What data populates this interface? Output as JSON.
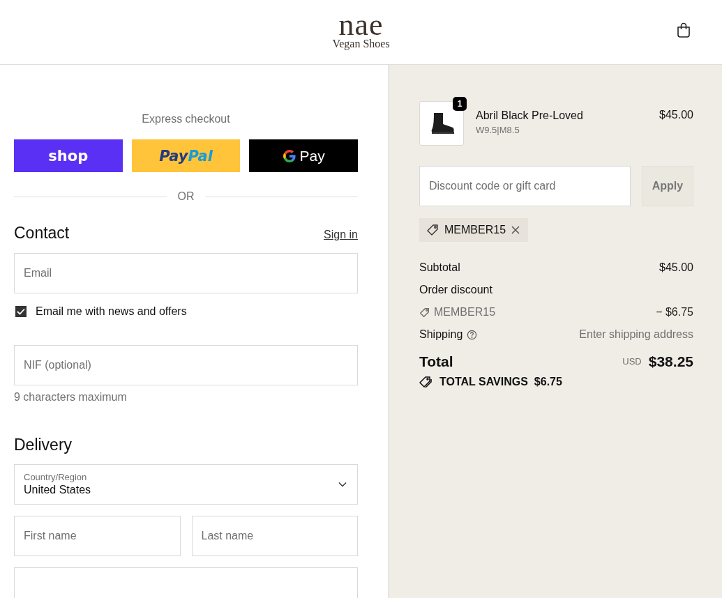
{
  "header": {
    "logo": "nae",
    "tagline": "Vegan Shoes"
  },
  "express_checkout": {
    "title": "Express checkout",
    "buttons": [
      {
        "kind": "shop",
        "label": "shop"
      },
      {
        "kind": "paypal",
        "label": "Pay",
        "label_2": "Pal"
      },
      {
        "kind": "gpay",
        "label": "Pay"
      }
    ],
    "divider": "OR"
  },
  "contact": {
    "heading": "Contact",
    "sign_in": "Sign in",
    "email": {
      "placeholder": "Email"
    },
    "newsletter": {
      "label": "Email me with news and offers",
      "checked": true
    },
    "nif": {
      "placeholder": "NIF (optional)",
      "hint": "9 characters maximum"
    }
  },
  "delivery": {
    "heading": "Delivery",
    "country": {
      "label": "Country/Region",
      "value": "United States"
    },
    "first_name": {
      "placeholder": "First name"
    },
    "last_name": {
      "placeholder": "Last name"
    }
  },
  "order": {
    "items": [
      {
        "name": "Abril Black Pre-Loved",
        "variant": "W9.5|M8.5",
        "quantity": "1",
        "price": "$45.00"
      }
    ],
    "discount": {
      "placeholder": "Discount code or gift card",
      "button": "Apply"
    },
    "applied_codes": [
      "MEMBER15"
    ],
    "summary": {
      "subtotal": {
        "label": "Subtotal",
        "value": "$45.00"
      },
      "order_discount": {
        "label": "Order discount",
        "code": "MEMBER15",
        "value": "− $6.75"
      },
      "shipping": {
        "label": "Shipping",
        "value": "Enter shipping address"
      },
      "total": {
        "label": "Total",
        "currency": "USD",
        "value": "$38.25"
      },
      "savings": {
        "label": "TOTAL SAVINGS",
        "value": "$6.75"
      }
    }
  }
}
